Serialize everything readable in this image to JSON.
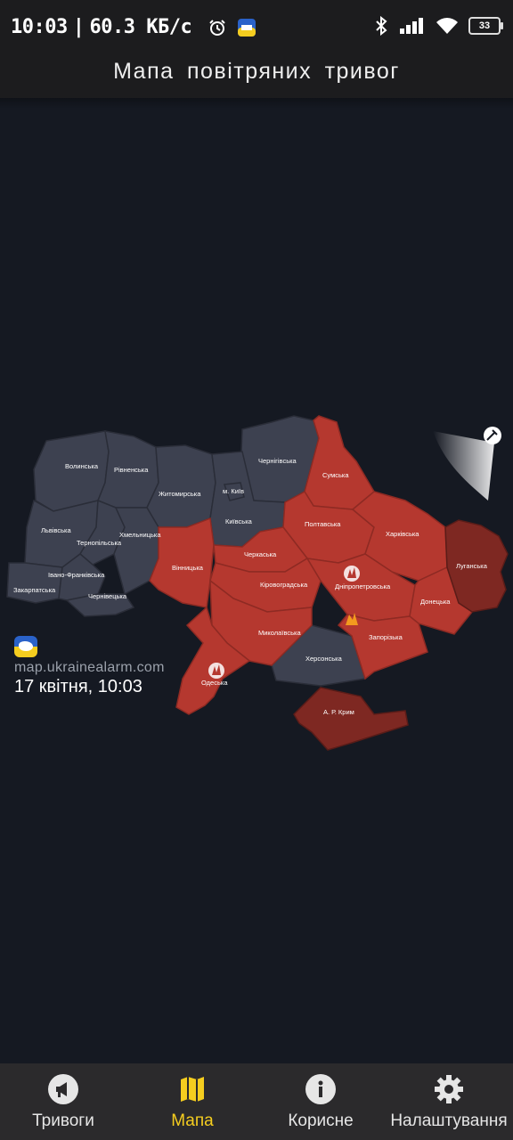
{
  "status_bar": {
    "time": "10:03",
    "separator": "|",
    "speed": "60.3 КБ/с",
    "battery": "33"
  },
  "header": {
    "title": "Мапа повітряних тривог"
  },
  "map": {
    "source_url": "map.ukrainealarm.com",
    "date": "17 квітня, 10:03",
    "colors": {
      "alert": "#b5382f",
      "alert_light": "#c8453a",
      "danger": "#7e2822",
      "calm": "#3d4150",
      "bg": "#151922"
    },
    "regions": {
      "volynska": "Волинська",
      "rivnenska": "Рівненська",
      "zhytomyrska": "Житомирська",
      "kyiv_city": "м. Київ",
      "chernihivska": "Чернігівська",
      "sumska": "Сумська",
      "lvivska": "Львівська",
      "ternopilska": "Тернопільська",
      "khmelnytska": "Хмельницька",
      "kyivska": "Київська",
      "poltavska": "Полтавська",
      "kharkivska": "Харківська",
      "luhanska": "Луганська",
      "zakarpatska": "Закарпатська",
      "ivano_frankivska": "Івано-Франківська",
      "chernivetska": "Чернівецька",
      "vinnytska": "Вінницька",
      "cherkaska": "Черкаська",
      "kirovohradska": "Кіровоградська",
      "dnipropetrovska": "Дніпропетровська",
      "donetska": "Донецька",
      "mykolaivska": "Миколаївська",
      "zaporizka": "Запорізька",
      "khersonska": "Херсонська",
      "odeska": "Одеська",
      "crimea": "А. Р. Крим"
    }
  },
  "nav": {
    "items": [
      {
        "label": "Тривоги",
        "icon": "megaphone-icon"
      },
      {
        "label": "Мапа",
        "icon": "map-icon"
      },
      {
        "label": "Корисне",
        "icon": "info-icon"
      },
      {
        "label": "Налаштування",
        "icon": "gear-icon"
      }
    ],
    "active": "Мапа"
  }
}
